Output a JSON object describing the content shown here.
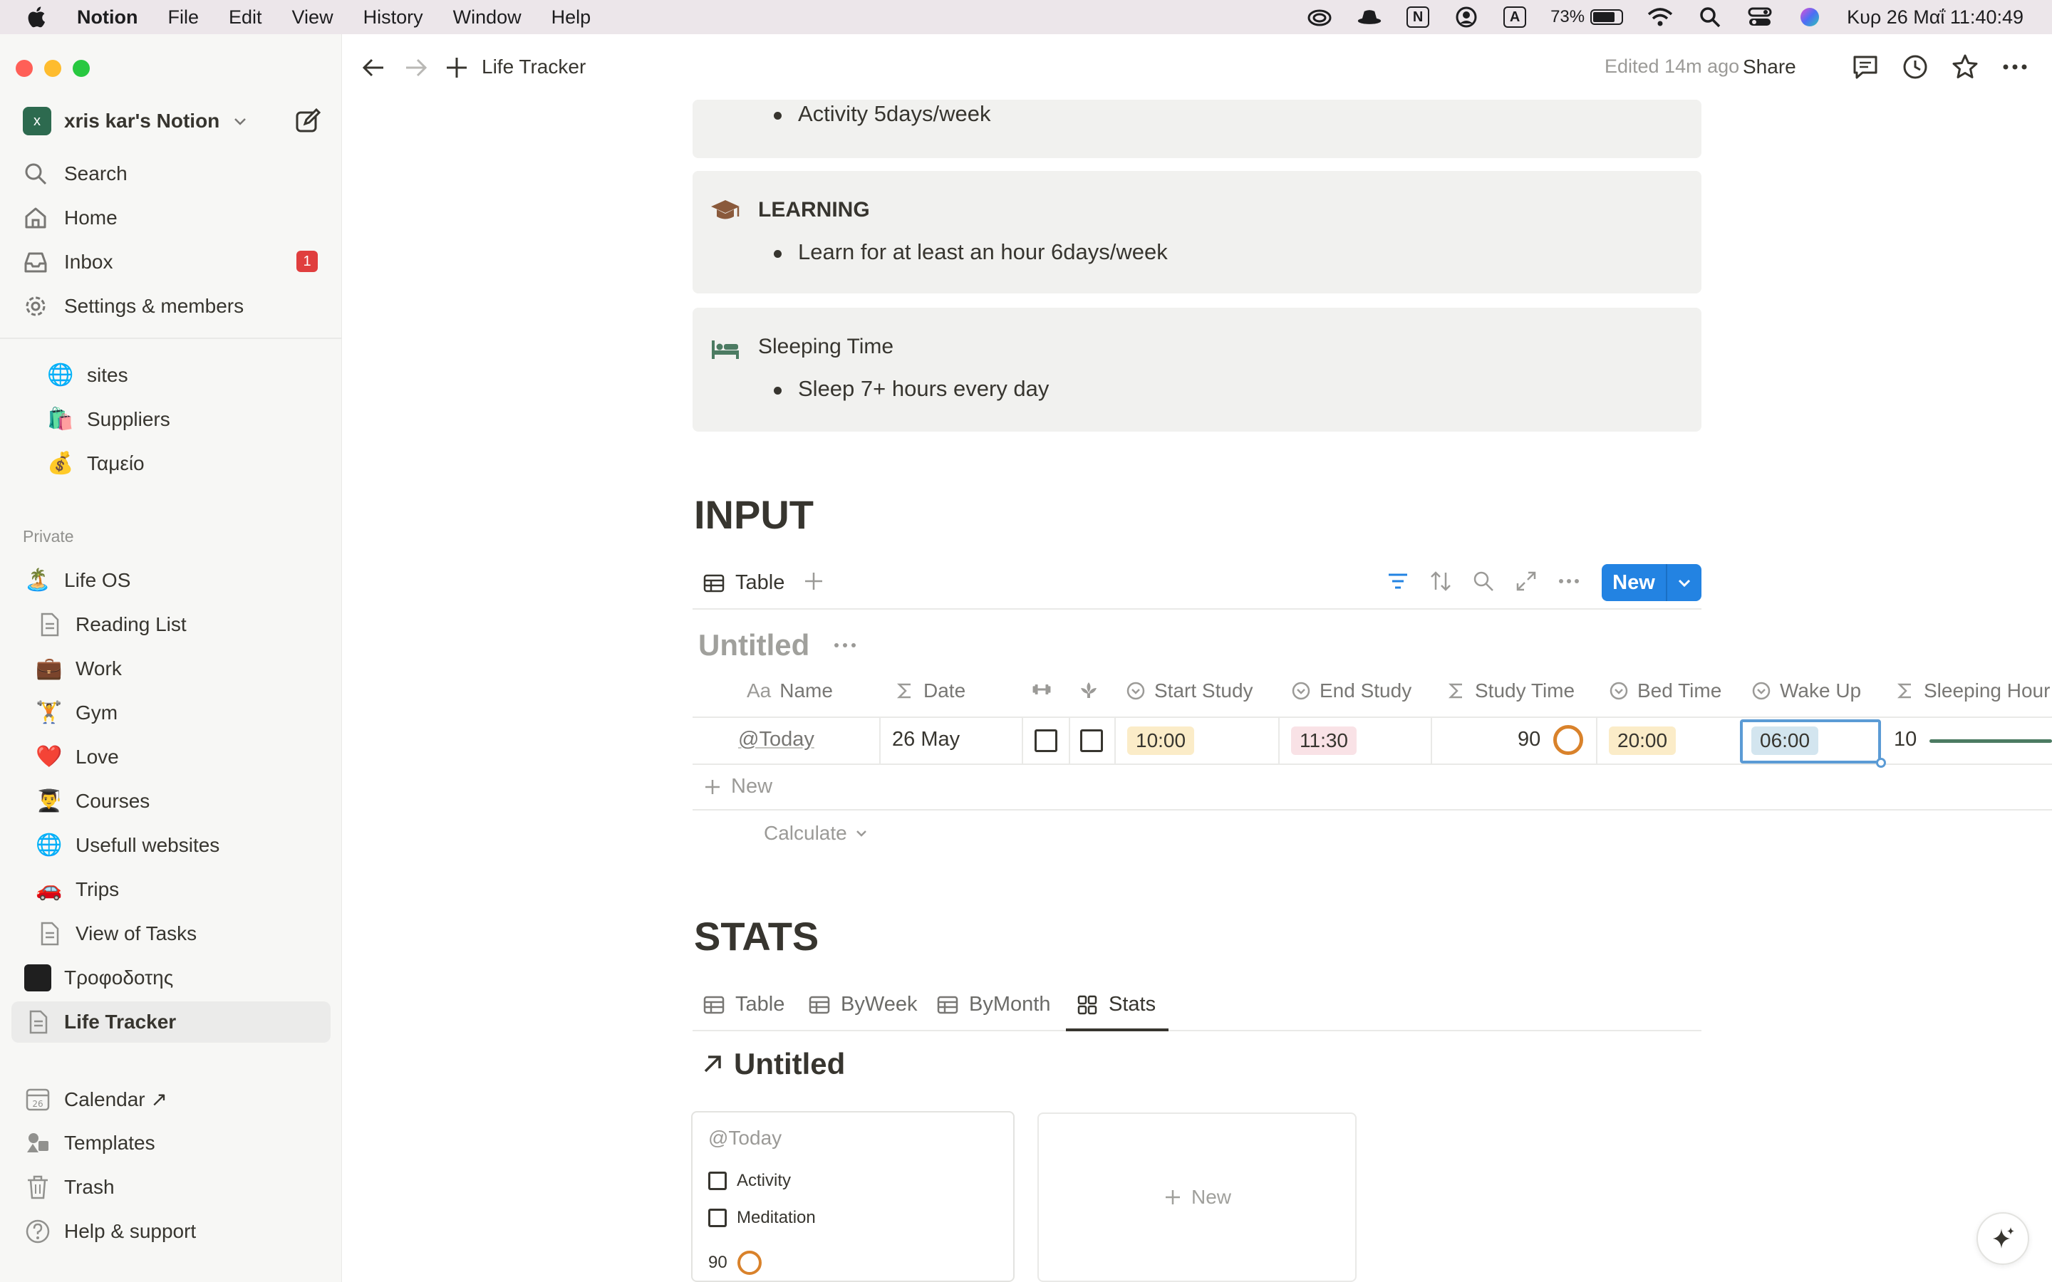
{
  "menubar": {
    "app_name": "Notion",
    "items": [
      "File",
      "Edit",
      "View",
      "History",
      "Window",
      "Help"
    ],
    "battery": "73%",
    "datetime": "Κυρ 26 Μαΐ  11:40:49",
    "box_icons": [
      "N",
      "A"
    ]
  },
  "sidebar": {
    "workspace_badge": "x",
    "workspace_name": "xris kar's Notion",
    "nav": {
      "search": "Search",
      "home": "Home",
      "inbox": "Inbox",
      "inbox_count": "1",
      "settings": "Settings & members"
    },
    "top_pages": [
      {
        "icon": "🌐",
        "label": "sites"
      },
      {
        "icon": "🛍️",
        "label": "Suppliers"
      },
      {
        "icon": "💰",
        "label": "Ταμείο"
      }
    ],
    "private_label": "Private",
    "life_os": {
      "icon": "🏝️",
      "label": "Life OS"
    },
    "pages": [
      {
        "icon": "📄",
        "label": "Reading List"
      },
      {
        "icon": "💼",
        "label": "Work"
      },
      {
        "icon": "🏋️",
        "label": "Gym"
      },
      {
        "icon": "❤️",
        "label": "Love"
      },
      {
        "icon": "👨‍🎓",
        "label": "Courses"
      },
      {
        "icon": "🌐",
        "label": "Usefull websites"
      },
      {
        "icon": "🚗",
        "label": "Trips"
      },
      {
        "icon": "📄",
        "label": "View of Tasks"
      }
    ],
    "trofodotis": {
      "icon": "⬛",
      "label": "Τροφοδοτης"
    },
    "life_tracker": {
      "icon": "📄",
      "label": "Life Tracker"
    },
    "bottom": {
      "calendar": "Calendar ↗",
      "templates": "Templates",
      "trash": "Trash",
      "help": "Help & support"
    }
  },
  "topbar": {
    "breadcrumb": "Life Tracker",
    "edited": "Edited 14m ago",
    "share": "Share"
  },
  "callouts": [
    {
      "title": "",
      "bullet": "Activity 5days/week"
    },
    {
      "title": "LEARNING",
      "bullet": "Learn for at least an hour 6days/week"
    },
    {
      "title": "Sleeping Time",
      "bullet": "Sleep 7+ hours every day"
    }
  ],
  "input_section": {
    "heading": "INPUT",
    "view_tab": "Table",
    "new_button": "New",
    "db_title": "Untitled",
    "columns": [
      "Name",
      "Date",
      "Start Study",
      "End Study",
      "Study Time",
      "Bed Time",
      "Wake Up",
      "Sleeping Hour"
    ],
    "column_prefix": "Aa",
    "row": {
      "name": "@Today",
      "date": "26 May",
      "start_study": "10:00",
      "end_study": "11:30",
      "study_time": "90",
      "bed_time": "20:00",
      "wake_up": "06:00",
      "sleeping_hours": "10"
    },
    "new_row": "New",
    "calculate": "Calculate"
  },
  "stats_section": {
    "heading": "STATS",
    "tabs": [
      "Table",
      "ByWeek",
      "ByMonth",
      "Stats"
    ],
    "active_tab": "Stats",
    "linked_title": "Untitled",
    "card": {
      "title": "@Today",
      "checks": [
        "Activity",
        "Meditation"
      ],
      "value": "90"
    },
    "gallery_new": "New"
  },
  "colors": {
    "accent": "#2383e2",
    "pill_yellow": "#fbecc8",
    "pill_pink": "#f9e2e6",
    "pill_blue": "#d3e5ef",
    "ring_orange": "#d9822b",
    "progress_green": "#4c7b62"
  }
}
